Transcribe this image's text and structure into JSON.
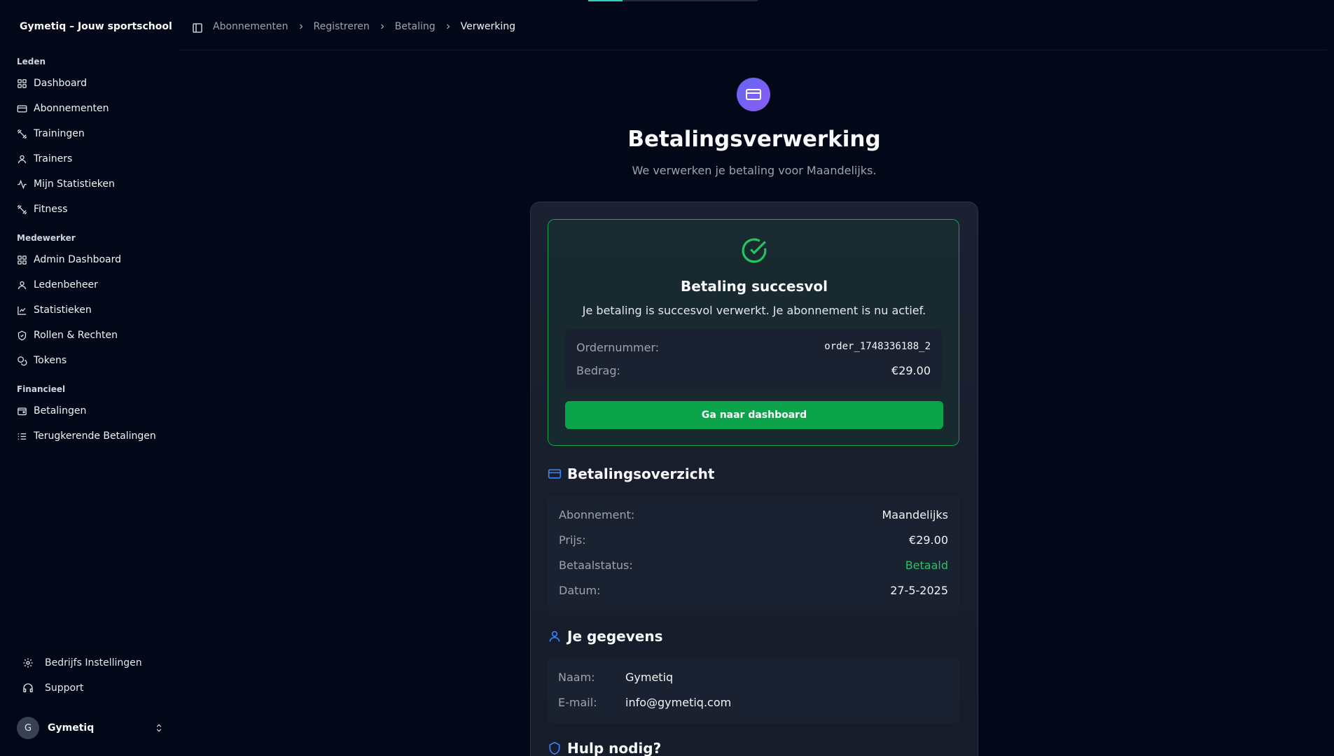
{
  "app": {
    "brand": "Gymetiq – Jouw sportschool"
  },
  "colors": {
    "accent": "#6366f1",
    "success": "#22c55e",
    "button": "#0ca44a",
    "background": "#020817"
  },
  "sidebar": {
    "groups": [
      {
        "label": "Leden",
        "items": [
          {
            "label": "Dashboard",
            "icon": "grid-icon"
          },
          {
            "label": "Abonnementen",
            "icon": "credit-card-icon"
          },
          {
            "label": "Trainingen",
            "icon": "dumbbell-icon"
          },
          {
            "label": "Trainers",
            "icon": "user-icon"
          },
          {
            "label": "Mijn Statistieken",
            "icon": "activity-icon"
          },
          {
            "label": "Fitness",
            "icon": "dumbbell-icon"
          }
        ]
      },
      {
        "label": "Medewerker",
        "items": [
          {
            "label": "Admin Dashboard",
            "icon": "grid-icon"
          },
          {
            "label": "Ledenbeheer",
            "icon": "user-icon"
          },
          {
            "label": "Statistieken",
            "icon": "chart-icon"
          },
          {
            "label": "Rollen & Rechten",
            "icon": "shield-icon"
          },
          {
            "label": "Tokens",
            "icon": "coins-icon"
          }
        ]
      },
      {
        "label": "Financieel",
        "items": [
          {
            "label": "Betalingen",
            "icon": "wallet-icon"
          },
          {
            "label": "Terugkerende Betalingen",
            "icon": "list-icon"
          }
        ]
      }
    ],
    "footer": [
      {
        "label": "Bedrijfs Instellingen",
        "icon": "gear-icon"
      },
      {
        "label": "Support",
        "icon": "headset-icon"
      }
    ],
    "user": {
      "initial": "G",
      "name": "Gymetiq"
    }
  },
  "breadcrumb": [
    "Abonnementen",
    "Registreren",
    "Betaling",
    "Verwerking"
  ],
  "main": {
    "title": "Betalingsverwerking",
    "subtitle": "We verwerken je betaling voor Maandelijks."
  },
  "success": {
    "title": "Betaling succesvol",
    "message": "Je betaling is succesvol verwerkt. Je abonnement is nu actief.",
    "order_label": "Ordernummer:",
    "order_value": "order_1748336188_2",
    "amount_label": "Bedrag:",
    "amount_value": "€29.00",
    "button": "Ga naar dashboard"
  },
  "overview": {
    "title": "Betalingsoverzicht",
    "rows": [
      {
        "label": "Abonnement:",
        "value": "Maandelijks"
      },
      {
        "label": "Prijs:",
        "value": "€29.00"
      },
      {
        "label": "Betaalstatus:",
        "value": "Betaald"
      },
      {
        "label": "Datum:",
        "value": "27-5-2025"
      }
    ]
  },
  "details": {
    "title": "Je gegevens",
    "rows": [
      {
        "label": "Naam:",
        "value": "Gymetiq"
      },
      {
        "label": "E-mail:",
        "value": "info@gymetiq.com"
      }
    ]
  },
  "help": {
    "title": "Hulp nodig?"
  }
}
